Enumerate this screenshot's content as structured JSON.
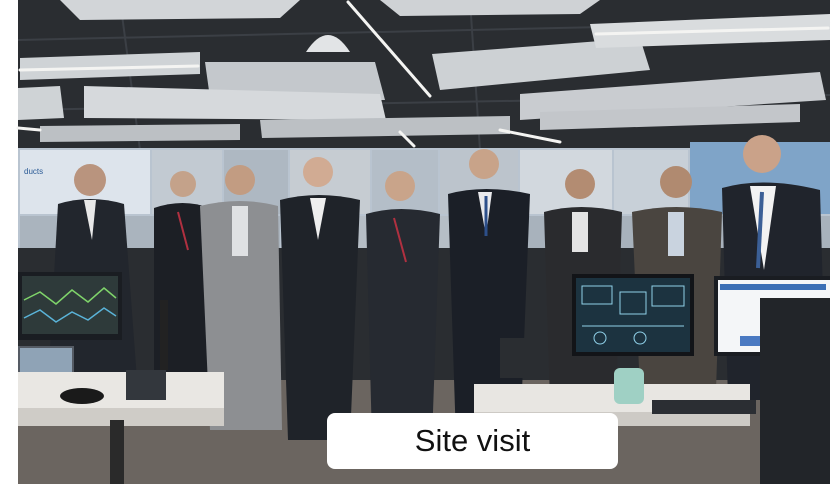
{
  "caption": {
    "text": "Site visit"
  },
  "colors": {
    "ceiling": "#2a2d31",
    "ceiling_panel": "#cfd3d6",
    "video_wall": "#c9d3df",
    "floor": "#6b6560",
    "suit_dark": "#1f2329",
    "suit_grey": "#8d8f92",
    "desk": "#e9e7e3",
    "caption_bg": "#ffffff"
  }
}
